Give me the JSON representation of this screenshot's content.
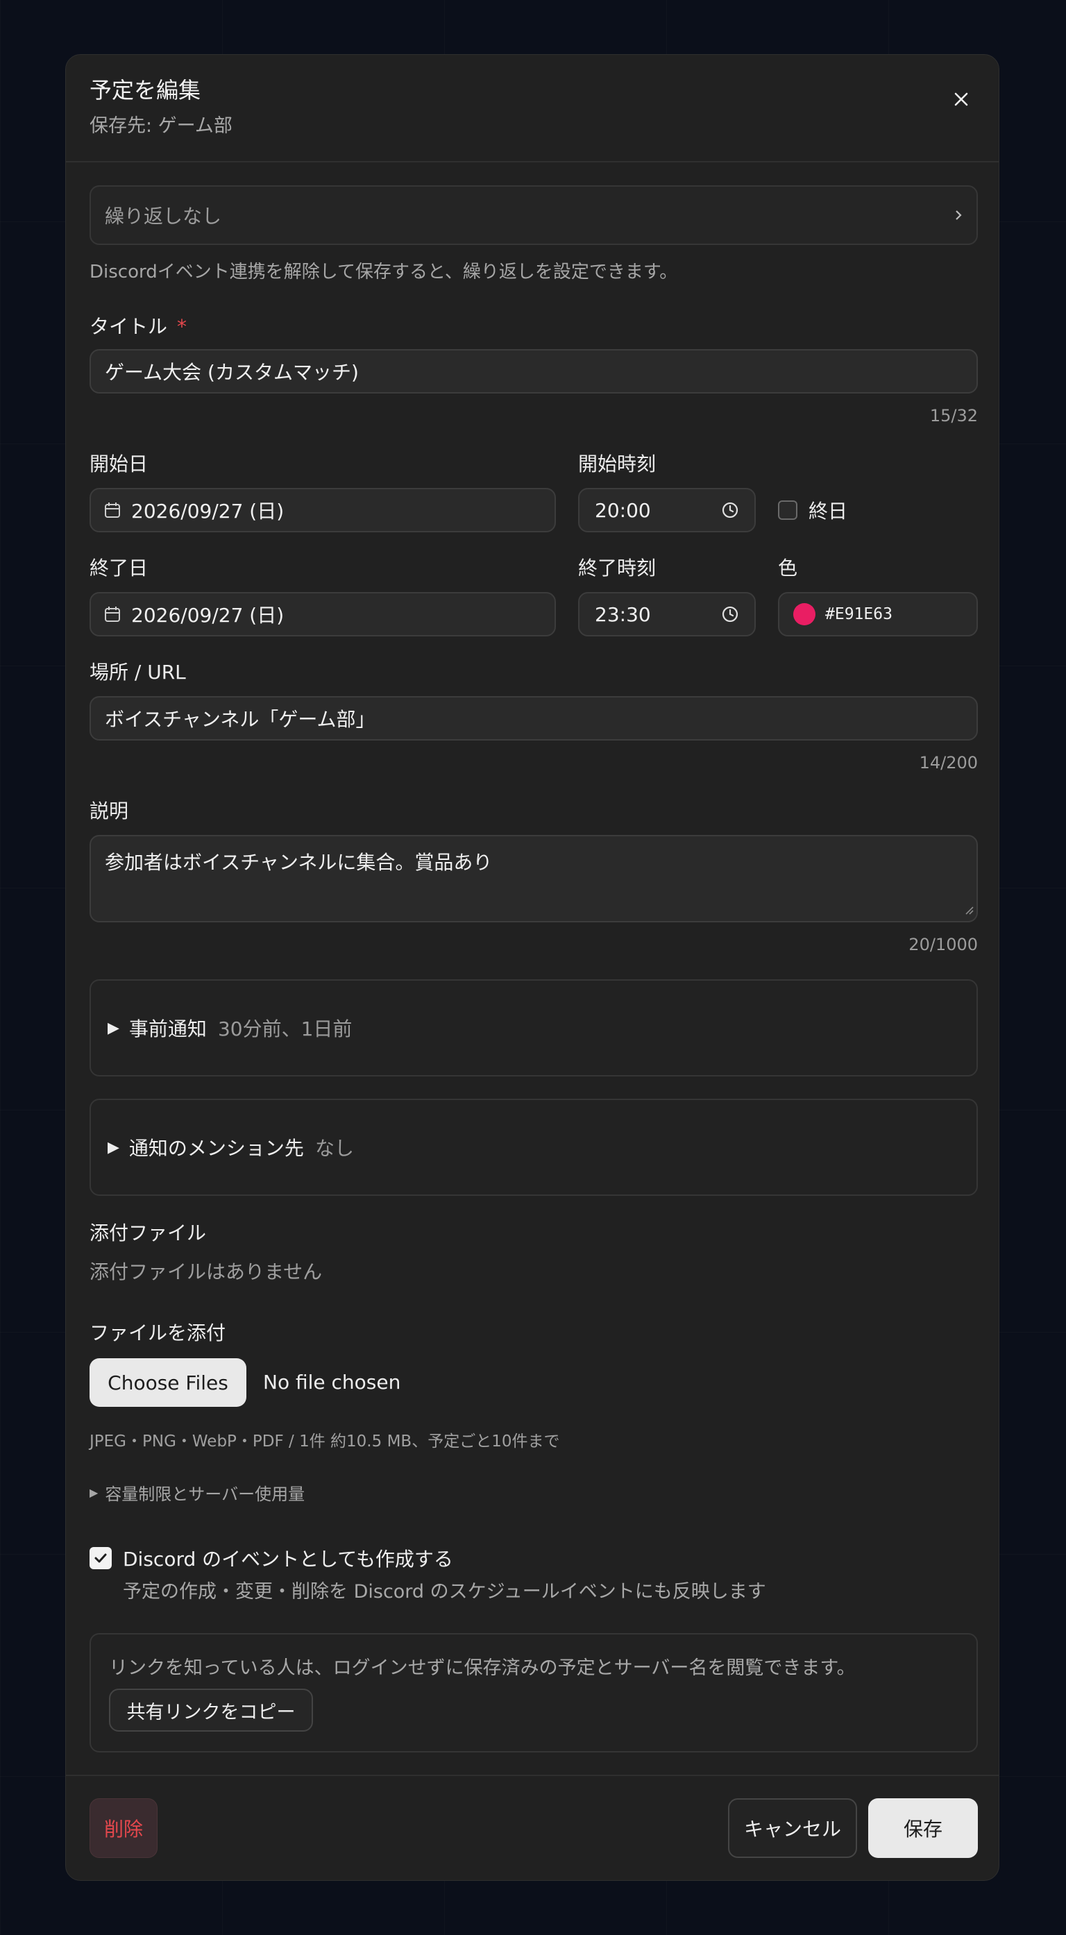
{
  "dialog": {
    "title": "予定を編集",
    "subtitle": "保存先: ゲーム部",
    "close_icon": "close-icon"
  },
  "recurrence": {
    "value": "繰り返しなし",
    "hint": "Discordイベント連携を解除して保存すると、繰り返しを設定できます。"
  },
  "title_field": {
    "label": "タイトル",
    "required_mark": "*",
    "value": "ゲーム大会 (カスタムマッチ)",
    "counter": "15/32"
  },
  "start": {
    "date_label": "開始日",
    "date_value": "2026/09/27 (日)",
    "time_label": "開始時刻",
    "time_value": "20:00",
    "allday_label": "終日",
    "allday_checked": false
  },
  "end": {
    "date_label": "終了日",
    "date_value": "2026/09/27 (日)",
    "time_label": "終了時刻",
    "time_value": "23:30"
  },
  "color": {
    "label": "色",
    "value": "#E91E63",
    "swatch": "#E91E63"
  },
  "location": {
    "label": "場所 / URL",
    "value": "ボイスチャンネル「ゲーム部」",
    "counter": "14/200"
  },
  "description": {
    "label": "説明",
    "value": "参加者はボイスチャンネルに集合。賞品あり",
    "counter": "20/1000"
  },
  "reminders": {
    "label": "事前通知",
    "value": "30分前、1日前"
  },
  "mentions": {
    "label": "通知のメンション先",
    "value": "なし"
  },
  "attachments": {
    "label": "添付ファイル",
    "empty": "添付ファイルはありません",
    "upload_label": "ファイルを添付",
    "choose_button": "Choose Files",
    "no_file": "No file chosen",
    "hint": "JPEG・PNG・WebP・PDF / 1件 約10.5 MB、予定ごと10件まで",
    "quota_toggle": "容量制限とサーバー使用量"
  },
  "discord": {
    "checkbox_label": "Discord のイベントとしても作成する",
    "checked": true,
    "description": "予定の作成・変更・削除を Discord のスケジュールイベントにも反映します"
  },
  "share": {
    "text": "リンクを知っている人は、ログインせずに保存済みの予定とサーバー名を閲覧できます。",
    "copy_button": "共有リンクをコピー"
  },
  "footer": {
    "delete": "削除",
    "cancel": "キャンセル",
    "save": "保存"
  }
}
